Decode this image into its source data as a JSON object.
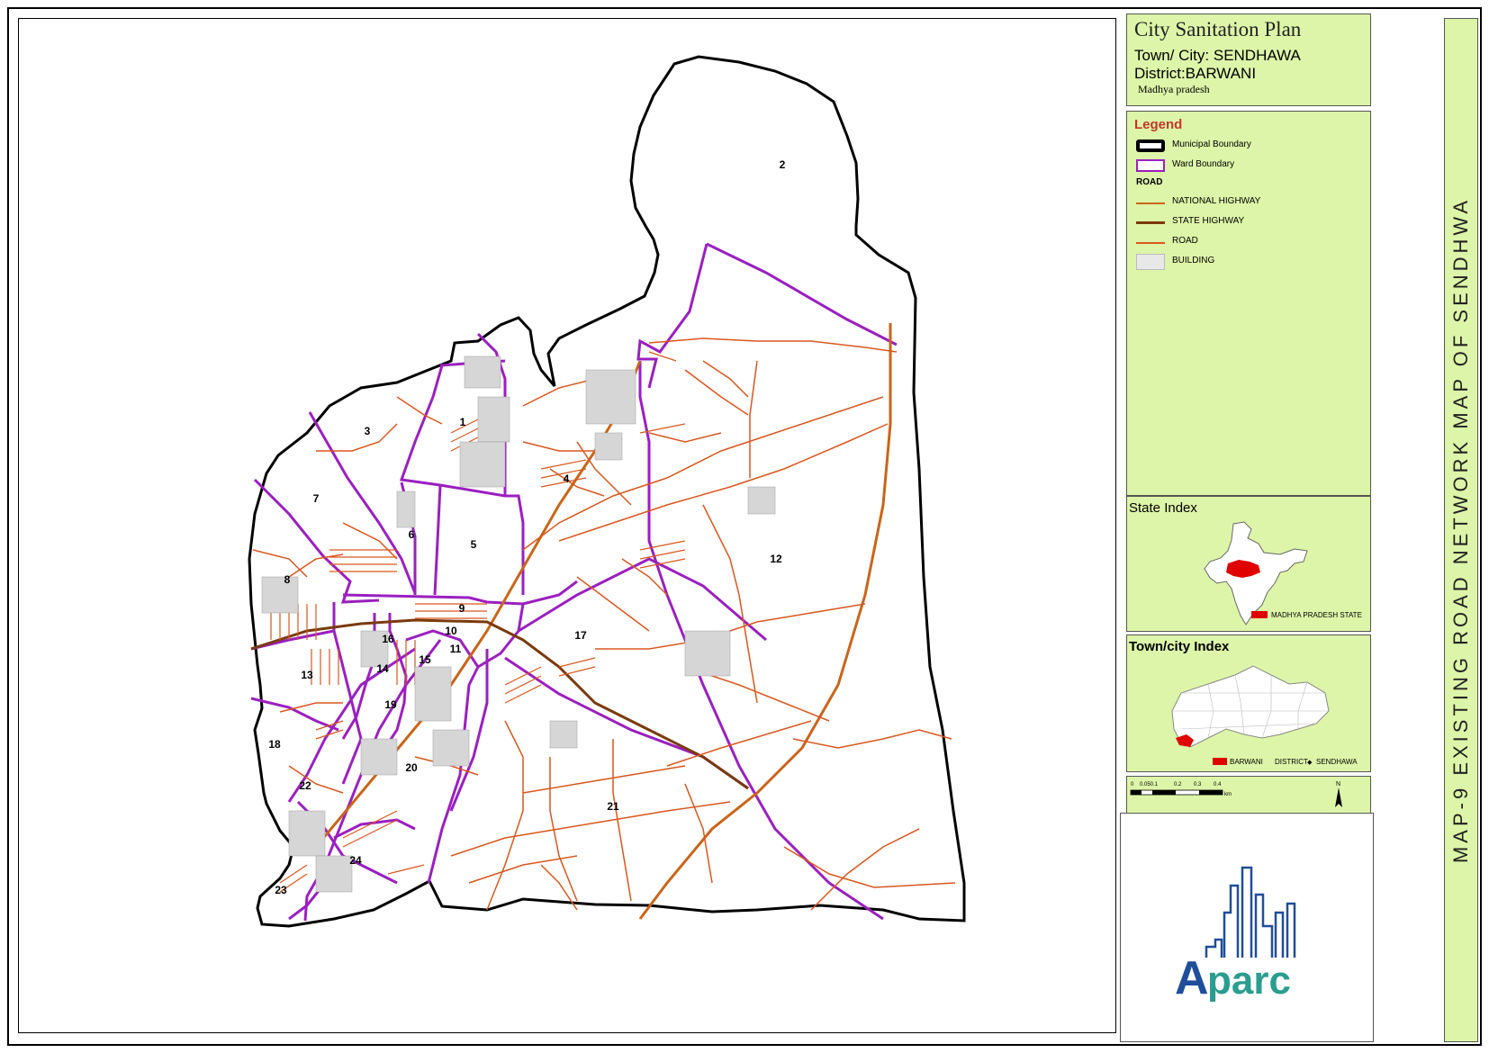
{
  "title_panel": {
    "title": "City Sanitation Plan",
    "town_label": "Town/ City: SENDHAWA",
    "district_label": "District:BARWANI",
    "state_label": "Madhya pradesh"
  },
  "legend": {
    "title": "Legend",
    "items": [
      {
        "label": "Municipal Boundary",
        "icon": "municipal-boundary-symbol",
        "color": "#000000"
      },
      {
        "label": "Ward Boundary",
        "icon": "ward-boundary-symbol",
        "color": "#9b1fc0"
      }
    ],
    "road_heading": "ROAD",
    "road_items": [
      {
        "label": "NATIONAL HIGHWAY",
        "color": "#c9651a"
      },
      {
        "label": "STATE HIGHWAY",
        "color": "#7a3a0c"
      },
      {
        "label": "ROAD",
        "color": "#d9571e"
      },
      {
        "label": "BUILDING",
        "color": "#e8e8e8"
      }
    ]
  },
  "state_index": {
    "title": "State Index",
    "legend_label": "MADHYA PRADESH STATE",
    "highlight_color": "#e00000"
  },
  "town_index": {
    "title": "Town/city Index",
    "district_label": "BARWANI",
    "district_word": "DISTRICT",
    "town_label": "SENDHAWA",
    "highlight_color": "#e00000"
  },
  "scale": {
    "ticks": [
      "0",
      "0.050.1",
      "0.2",
      "0.3",
      "0.4"
    ],
    "unit": "km",
    "north_label": "N"
  },
  "vertical_title": "MAP-9 EXISTING ROAD NETWORK MAP OF SENDHWA",
  "logo": {
    "text": "Aparc",
    "color_a": "#1f4e9a",
    "color_rest": "#2a9d8f"
  },
  "wards": [
    "1",
    "2",
    "3",
    "4",
    "5",
    "6",
    "7",
    "8",
    "9",
    "10",
    "11",
    "12",
    "13",
    "14",
    "15",
    "16",
    "17",
    "18",
    "19",
    "20",
    "21",
    "22",
    "23",
    "24"
  ],
  "colors": {
    "panel_bg": "#ddf5a8",
    "municipal_boundary": "#000000",
    "ward_boundary": "#9b1fc0",
    "road": "#d9571e",
    "national_highway": "#c9651a"
  }
}
